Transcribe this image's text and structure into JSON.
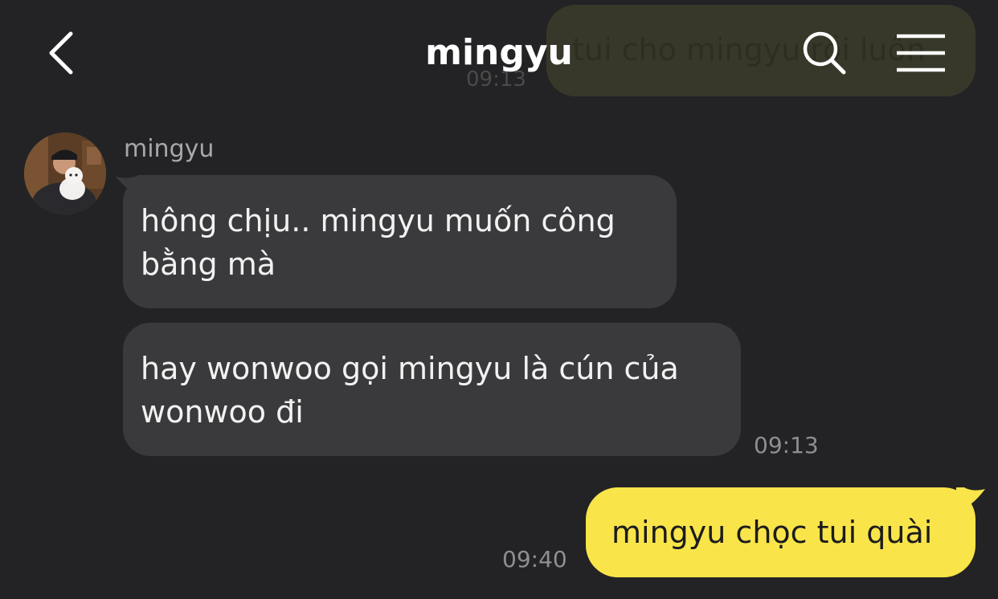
{
  "header": {
    "title": "mingyu",
    "back_icon": "chevron-left-icon",
    "search_icon": "search-icon",
    "menu_icon": "hamburger-menu-icon"
  },
  "ghost_message": {
    "text": "tui cho mingyu rồi luôn",
    "time": "09:13"
  },
  "chat": {
    "sender_name": "mingyu",
    "messages": [
      {
        "text_line1": "hông chịu.. mingyu muốn công",
        "text_line2": "bằng mà"
      },
      {
        "text_line1": "hay wonwoo gọi mingyu là cún của",
        "text_line2": "wonwoo đi"
      }
    ],
    "time_received": "09:13",
    "my_message": "mingyu chọc tui quài",
    "time_sent": "09:40"
  },
  "colors": {
    "background": "#232325",
    "received_bubble": "#3a3a3c",
    "sent_bubble": "#f9e54a"
  }
}
